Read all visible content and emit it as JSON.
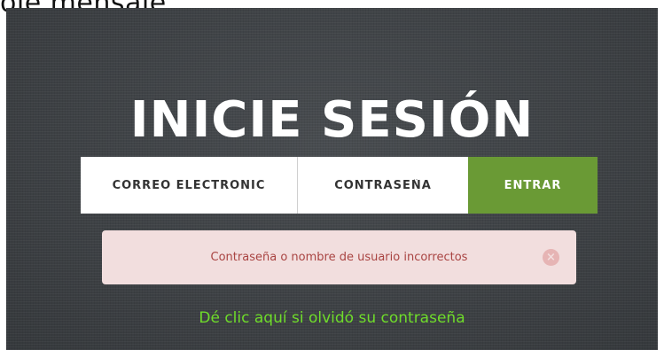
{
  "caption": "ole mensaje",
  "login": {
    "title": "INICIE SESIÓN",
    "email_placeholder": "CORREO ELECTRÓNIC",
    "password_placeholder": "CONTRASEÑA",
    "submit_label": "ENTRAR"
  },
  "alert": {
    "message": "Contraseña o nombre de usuario incorrectos",
    "close_glyph": "×"
  },
  "forgot_link": "Dé clic aquí si olvidó su contraseña",
  "colors": {
    "panel_bg": "#3f4347",
    "submit_bg": "#6a9a35",
    "alert_bg": "#f2dede",
    "alert_text": "#a94442",
    "link": "#6fdc2a"
  }
}
